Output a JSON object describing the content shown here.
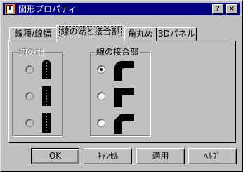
{
  "window": {
    "title": "図形プロパティ",
    "app_icon_glyph": "T",
    "help_glyph": "?",
    "close_glyph": "×"
  },
  "tabs": [
    {
      "label": "線種/線幅",
      "active": false
    },
    {
      "label": "線の端と接合部",
      "active": true
    },
    {
      "label": "角丸め",
      "active": false
    },
    {
      "label": "3Dパネル",
      "active": false
    }
  ],
  "line_end_group": {
    "label": "線の端",
    "enabled": false,
    "options": [
      {
        "style": "round",
        "selected": false
      },
      {
        "style": "square",
        "selected": false
      },
      {
        "style": "flat",
        "selected": false
      }
    ]
  },
  "join_group": {
    "label": "線の接合部",
    "enabled": true,
    "options": [
      {
        "style": "round-join",
        "selected": true
      },
      {
        "style": "miter-join",
        "selected": false
      },
      {
        "style": "bevel-join",
        "selected": false
      }
    ]
  },
  "buttons": {
    "ok": "OK",
    "cancel": "ｷｬﾝｾﾙ",
    "apply": "適用",
    "help": "ﾍﾙﾌﾟ"
  },
  "colors": {
    "titlebar": "#000080",
    "face": "#c0c0c0",
    "icon_accent": "#ff8000"
  }
}
